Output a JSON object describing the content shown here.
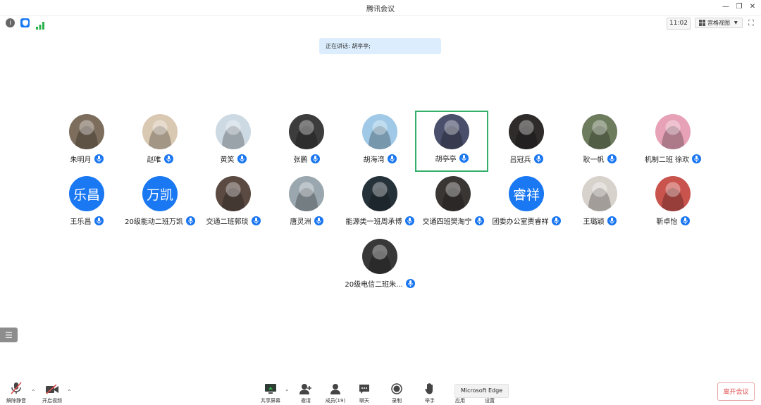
{
  "window": {
    "title": "腾讯会议"
  },
  "toolbar": {
    "time": "11:02",
    "view_label": "宫格视图"
  },
  "banner": {
    "speaking": "正在讲话: 胡亭亭;"
  },
  "participants": [
    {
      "name": "朱明月",
      "avatar_text": "",
      "color": "#7d6d5c"
    },
    {
      "name": "赵唯",
      "avatar_text": "",
      "color": "#d9c8b2"
    },
    {
      "name": "黄笑",
      "avatar_text": "",
      "color": "#cdd9e3"
    },
    {
      "name": "张鹏",
      "avatar_text": "",
      "color": "#3c3c3c"
    },
    {
      "name": "胡海湾",
      "avatar_text": "",
      "color": "#9fc9e6"
    },
    {
      "name": "胡亭亭",
      "avatar_text": "",
      "color": "#4a4f6b"
    },
    {
      "name": "吕冠兵",
      "avatar_text": "",
      "color": "#2e2b2a"
    },
    {
      "name": "耿一帆",
      "avatar_text": "",
      "color": "#6e7c5e"
    },
    {
      "name": "机制二班  徐欢",
      "avatar_text": "",
      "color": "#e7a2b8"
    },
    {
      "name": "王乐昌",
      "avatar_text": "乐昌",
      "color": "#1978f2"
    },
    {
      "name": "20级能动二班万凯",
      "avatar_text": "万凯",
      "color": "#1978f2"
    },
    {
      "name": "交通二班郭琰",
      "avatar_text": "",
      "color": "#5a4a42"
    },
    {
      "name": "唐灵洲",
      "avatar_text": "",
      "color": "#9aa7ae"
    },
    {
      "name": "能源类一班周承博",
      "avatar_text": "",
      "color": "#26323a"
    },
    {
      "name": "交通四班樊淘宁",
      "avatar_text": "",
      "color": "#3a3634"
    },
    {
      "name": "团委办公室贾睿祥",
      "avatar_text": "睿祥",
      "color": "#1978f2"
    },
    {
      "name": "王璐颖",
      "avatar_text": "",
      "color": "#d8d2cc"
    },
    {
      "name": "靳卓怡",
      "avatar_text": "",
      "color": "#c9534d"
    },
    {
      "name": "20级电信二班朱...",
      "avatar_text": "",
      "color": "#383838"
    }
  ],
  "active_speaker": "胡亭亭",
  "bottom_bar": {
    "unmute": "解除静音",
    "video": "开启视频",
    "share": "共享屏幕",
    "invite": "邀请",
    "members": "成员(19)",
    "chat": "聊天",
    "record": "录制",
    "raise_hand": "举手",
    "apps": "应用",
    "settings": "设置",
    "leave": "离开会议"
  },
  "tooltip": {
    "text": "Microsoft Edge"
  },
  "colors": {
    "accent": "#1978f2",
    "active_border": "#33b06a",
    "leave": "#e04b4b"
  }
}
